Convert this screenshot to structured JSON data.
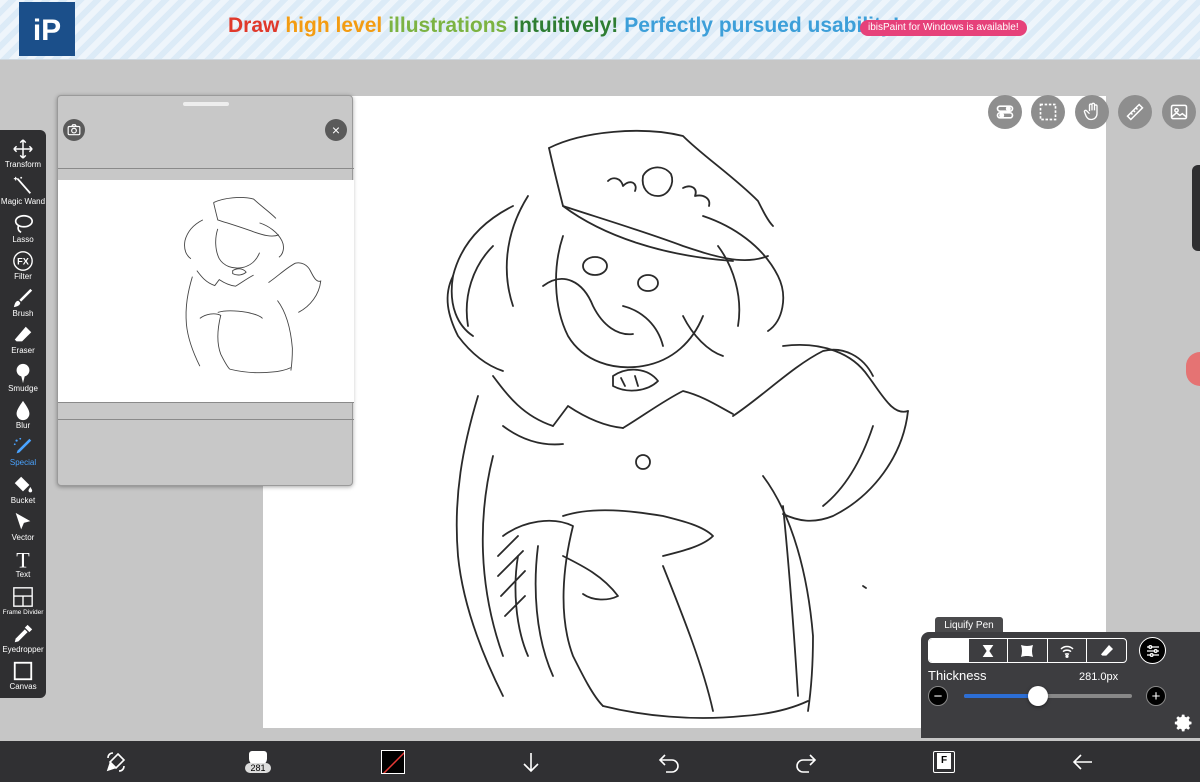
{
  "banner": {
    "logo_letters": "iP",
    "slogan_parts": [
      {
        "text": "Draw",
        "color": "#e0392b"
      },
      {
        "text": "high level",
        "color": "#f39c12"
      },
      {
        "text": "illustrations",
        "color": "#7cb342"
      },
      {
        "text": "intuitively!",
        "color": "#2e7d32"
      },
      {
        "text": "Perfectly pursued usability!",
        "color": "#3d9fd9"
      }
    ],
    "promo_badge": "ibisPaint for Windows is available!"
  },
  "toolbar": {
    "items": [
      {
        "label": "Transform",
        "icon": "move-arrows-icon"
      },
      {
        "label": "Magic Wand",
        "icon": "magic-wand-icon"
      },
      {
        "label": "Lasso",
        "icon": "lasso-icon"
      },
      {
        "label": "Filter",
        "icon": "fx-icon",
        "glyph": "FX"
      },
      {
        "label": "Brush",
        "icon": "brush-icon"
      },
      {
        "label": "Eraser",
        "icon": "eraser-icon"
      },
      {
        "label": "Smudge",
        "icon": "smudge-icon"
      },
      {
        "label": "Blur",
        "icon": "blur-drop-icon"
      },
      {
        "label": "Special",
        "icon": "special-pen-icon",
        "active": true
      },
      {
        "label": "Bucket",
        "icon": "bucket-icon"
      },
      {
        "label": "Vector",
        "icon": "vector-cursor-icon"
      },
      {
        "label": "Text",
        "icon": "text-icon",
        "glyph": "T"
      },
      {
        "label": "Frame Divider",
        "icon": "frame-divider-icon"
      },
      {
        "label": "Eyedropper",
        "icon": "eyedropper-icon"
      },
      {
        "label": "Canvas",
        "icon": "canvas-icon"
      }
    ],
    "active_color": "#4aa3ff"
  },
  "layer_panel": {
    "close_glyph": "×"
  },
  "canvas_buttons": [
    "layer-toggle-icon",
    "selection-icon",
    "hand-icon",
    "ruler-icon",
    "reference-image-icon"
  ],
  "liquify": {
    "tab_label": "Liquify Pen",
    "modes": [
      "push-icon",
      "pinch-icon",
      "expand-icon",
      "swirl-icon",
      "restore-icon"
    ],
    "active_mode": 0,
    "thickness_label": "Thickness",
    "thickness_value": "281.0px",
    "thickness_fraction": 0.44,
    "minus_glyph": "−",
    "plus_glyph": "+"
  },
  "bottom_bar": {
    "brush_size": "281",
    "layer_glyph": "F",
    "current_color": "#000000"
  }
}
